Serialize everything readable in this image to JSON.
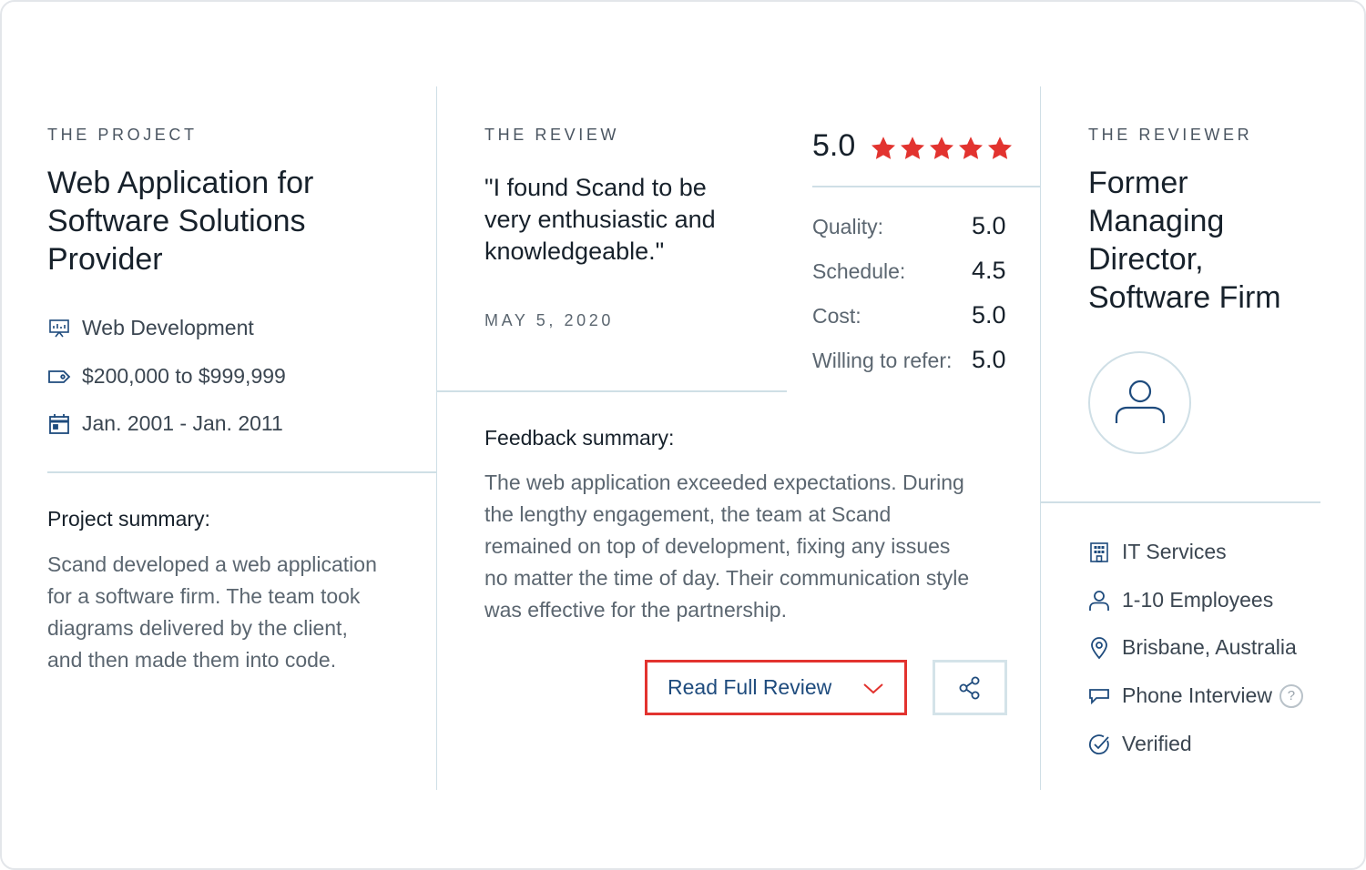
{
  "project": {
    "eyebrow": "THE PROJECT",
    "title_lines": [
      "Web Application for",
      "Software Solutions",
      "Provider"
    ],
    "service": "Web Development",
    "budget": "$200,000 to $999,999",
    "dates": "Jan. 2001 - Jan. 2011",
    "summary_heading": "Project summary:",
    "summary_lines": [
      "Scand developed a web application",
      "for a software firm. The team took",
      "diagrams delivered by the client,",
      "and then made them into code."
    ]
  },
  "review": {
    "eyebrow": "THE REVIEW",
    "quote_lines": [
      "\"I found Scand to be",
      "very enthusiastic and",
      "knowledgeable.\""
    ],
    "date": "MAY 5, 2020",
    "overall": "5.0",
    "stars": 5,
    "star_color": "#e2332f",
    "ratings": [
      {
        "label": "Quality:",
        "value": "5.0"
      },
      {
        "label": "Schedule:",
        "value": "4.5"
      },
      {
        "label": "Cost:",
        "value": "5.0"
      },
      {
        "label": "Willing to refer:",
        "value": "5.0"
      }
    ],
    "feedback_heading": "Feedback summary:",
    "feedback_lines": [
      "The web application exceeded expectations. During",
      "the lengthy engagement, the team at Scand",
      "remained on top of development, fixing any issues",
      "no matter the time of day. Their communication style",
      "was effective for the partnership."
    ],
    "read_full_label": "Read Full Review",
    "accent_color": "#1e4b7d",
    "highlight_color": "#e2332f"
  },
  "reviewer": {
    "eyebrow": "THE REVIEWER",
    "title_lines": [
      "Former",
      "Managing",
      "Director,",
      "Software Firm"
    ],
    "industry": "IT Services",
    "size": "1-10 Employees",
    "location": "Brisbane, Australia",
    "interview": "Phone Interview",
    "help_glyph": "?",
    "verified": "Verified"
  },
  "icons": {
    "service": "presentation-icon",
    "budget": "tag-icon",
    "dates": "calendar-icon",
    "overall_rating": "star-icon",
    "read_full": "chevron-down-icon",
    "share": "share-icon",
    "avatar": "user-icon",
    "industry": "building-icon",
    "size": "user-icon",
    "location": "map-pin-icon",
    "interview": "chat-bubble-icon",
    "help": "question-mark-icon",
    "verified": "check-circle-icon"
  }
}
